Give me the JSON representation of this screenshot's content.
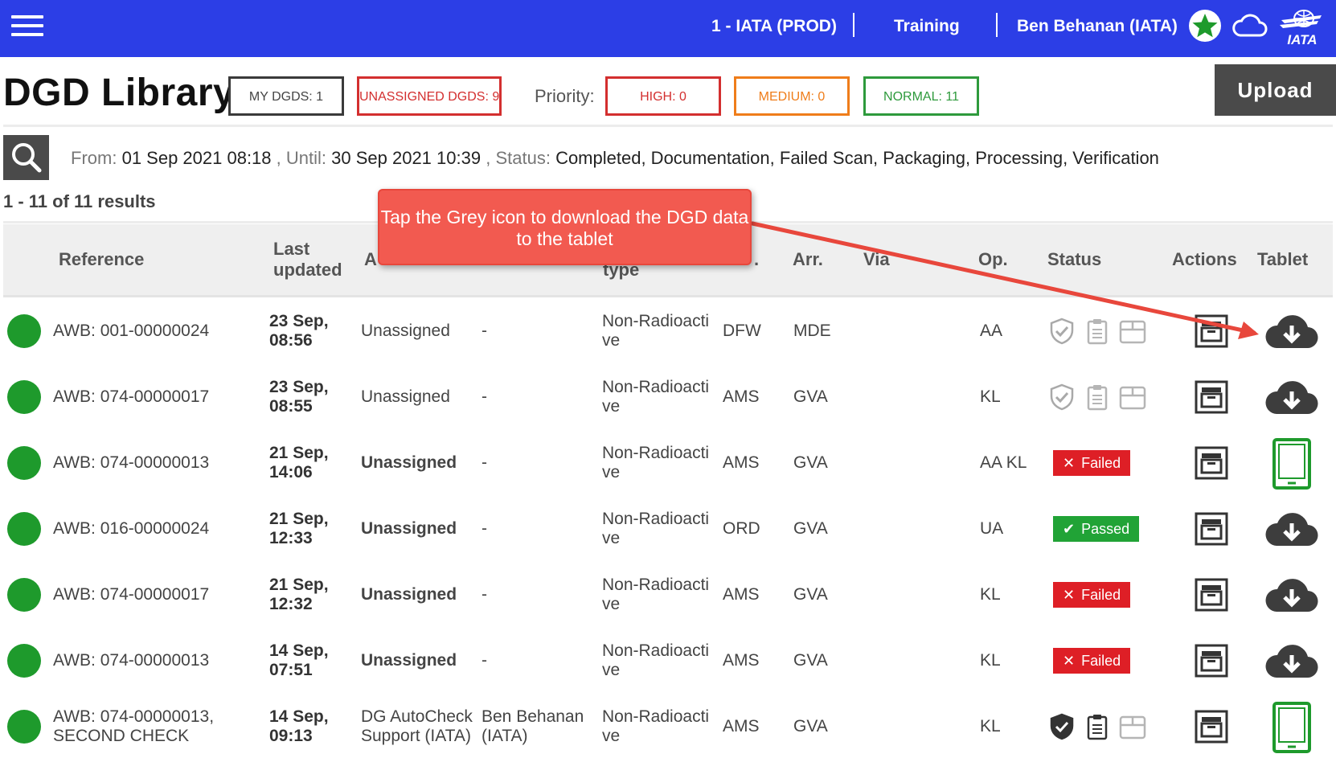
{
  "topbar": {
    "menu_icon": "hamburger-menu-icon",
    "org": "1 - IATA (PROD)",
    "mode": "Training",
    "user": "Ben Behanan (IATA)",
    "icons": [
      "star-icon",
      "cloud-icon",
      "iata-logo"
    ],
    "logo_text": "IATA",
    "bar_color": "#2c3ee6"
  },
  "header": {
    "title": "DGD Library",
    "my_dgds": "MY DGDS: 1",
    "unassigned_dgds": "UNASSIGNED DGDS: 9",
    "priority_label": "Priority:",
    "high": "HIGH: 0",
    "medium": "MEDIUM: 0",
    "normal": "NORMAL: 11",
    "upload": "Upload"
  },
  "filter": {
    "from_label": "From:",
    "from": "01 Sep 2021 08:18",
    "until_label": ", Until:",
    "until": "30 Sep 2021 10:39",
    "status_label": ", Status:",
    "statuses": "Completed, Documentation, Failed Scan, Packaging, Processing, Verification"
  },
  "results_summary": "1 - 11 of 11 results",
  "table": {
    "columns": {
      "reference": "Reference",
      "last_updated_1": "Last",
      "last_updated_2": "updated",
      "assigned_partial": "A",
      "type_partial": "type",
      "dep_partial": ".",
      "arr": "Arr.",
      "via": "Via",
      "op": "Op.",
      "status": "Status",
      "actions": "Actions",
      "tablet": "Tablet"
    },
    "rows": [
      {
        "ref1": "AWB: 001-00000024",
        "ref2": "",
        "date": "23 Sep,",
        "time": "08:56",
        "assigned1": "Unassigned",
        "assigned2": "",
        "assigned_bold": false,
        "agent1": "-",
        "agent2": "",
        "type1": "Non-Radioacti",
        "type2": "ve",
        "dep": "DFW",
        "arr": "MDE",
        "op": "AA",
        "status": "icons",
        "status_icons_active": false,
        "tablet": "download"
      },
      {
        "ref1": "AWB: 074-00000017",
        "ref2": "",
        "date": "23 Sep,",
        "time": "08:55",
        "assigned1": "Unassigned",
        "assigned2": "",
        "assigned_bold": false,
        "agent1": "-",
        "agent2": "",
        "type1": "Non-Radioacti",
        "type2": "ve",
        "dep": "AMS",
        "arr": "GVA",
        "op": "KL",
        "status": "icons",
        "status_icons_active": false,
        "tablet": "download"
      },
      {
        "ref1": "AWB: 074-00000013",
        "ref2": "",
        "date": "21 Sep,",
        "time": "14:06",
        "assigned1": "Unassigned",
        "assigned2": "",
        "assigned_bold": true,
        "agent1": "-",
        "agent2": "",
        "type1": "Non-Radioacti",
        "type2": "ve",
        "dep": "AMS",
        "arr": "GVA",
        "op": "AA KL",
        "status": "Failed",
        "tablet": "on-tablet"
      },
      {
        "ref1": "AWB: 016-00000024",
        "ref2": "",
        "date": "21 Sep,",
        "time": "12:33",
        "assigned1": "Unassigned",
        "assigned2": "",
        "assigned_bold": true,
        "agent1": "-",
        "agent2": "",
        "type1": "Non-Radioacti",
        "type2": "ve",
        "dep": "ORD",
        "arr": "GVA",
        "op": "UA",
        "status": "Passed",
        "tablet": "download"
      },
      {
        "ref1": "AWB: 074-00000017",
        "ref2": "",
        "date": "21 Sep,",
        "time": "12:32",
        "assigned1": "Unassigned",
        "assigned2": "",
        "assigned_bold": true,
        "agent1": "-",
        "agent2": "",
        "type1": "Non-Radioacti",
        "type2": "ve",
        "dep": "AMS",
        "arr": "GVA",
        "op": "KL",
        "status": "Failed",
        "tablet": "download"
      },
      {
        "ref1": "AWB: 074-00000013",
        "ref2": "",
        "date": "14 Sep,",
        "time": "07:51",
        "assigned1": "Unassigned",
        "assigned2": "",
        "assigned_bold": true,
        "agent1": "-",
        "agent2": "",
        "type1": "Non-Radioacti",
        "type2": "ve",
        "dep": "AMS",
        "arr": "GVA",
        "op": "KL",
        "status": "Failed",
        "tablet": "download"
      },
      {
        "ref1": "AWB: 074-00000013,",
        "ref2": "SECOND CHECK",
        "date": "14 Sep,",
        "time": "09:13",
        "assigned1": "DG AutoCheck",
        "assigned2": "Support (IATA)",
        "assigned_bold": false,
        "agent1": "Ben Behanan",
        "agent2": "(IATA)",
        "type1": "Non-Radioacti",
        "type2": "ve",
        "dep": "AMS",
        "arr": "GVA",
        "op": "KL",
        "status": "icons",
        "status_icons_active": true,
        "tablet": "on-tablet"
      }
    ]
  },
  "callout": {
    "text": "Tap the Grey icon to download the DGD data to the tablet"
  },
  "colors": {
    "status_ok_dot": "#1e9a2c",
    "failed": "#de1f26",
    "passed": "#21a336",
    "tablet_green": "#1e9a2c",
    "callout": "#f25a50",
    "unassigned_border": "#d32f2f",
    "high_border": "#d32f2f",
    "medium_border": "#ef7d1a",
    "normal_border": "#2e9a3c"
  },
  "icon_names": {
    "status_shield": "shield-check-icon",
    "status_clipboard": "clipboard-icon",
    "status_box": "package-icon",
    "action_archive": "archive-icon",
    "tablet_download": "cloud-download-icon",
    "tablet_device": "tablet-icon",
    "failed": "x-icon",
    "passed": "check-icon",
    "search": "search-icon"
  }
}
